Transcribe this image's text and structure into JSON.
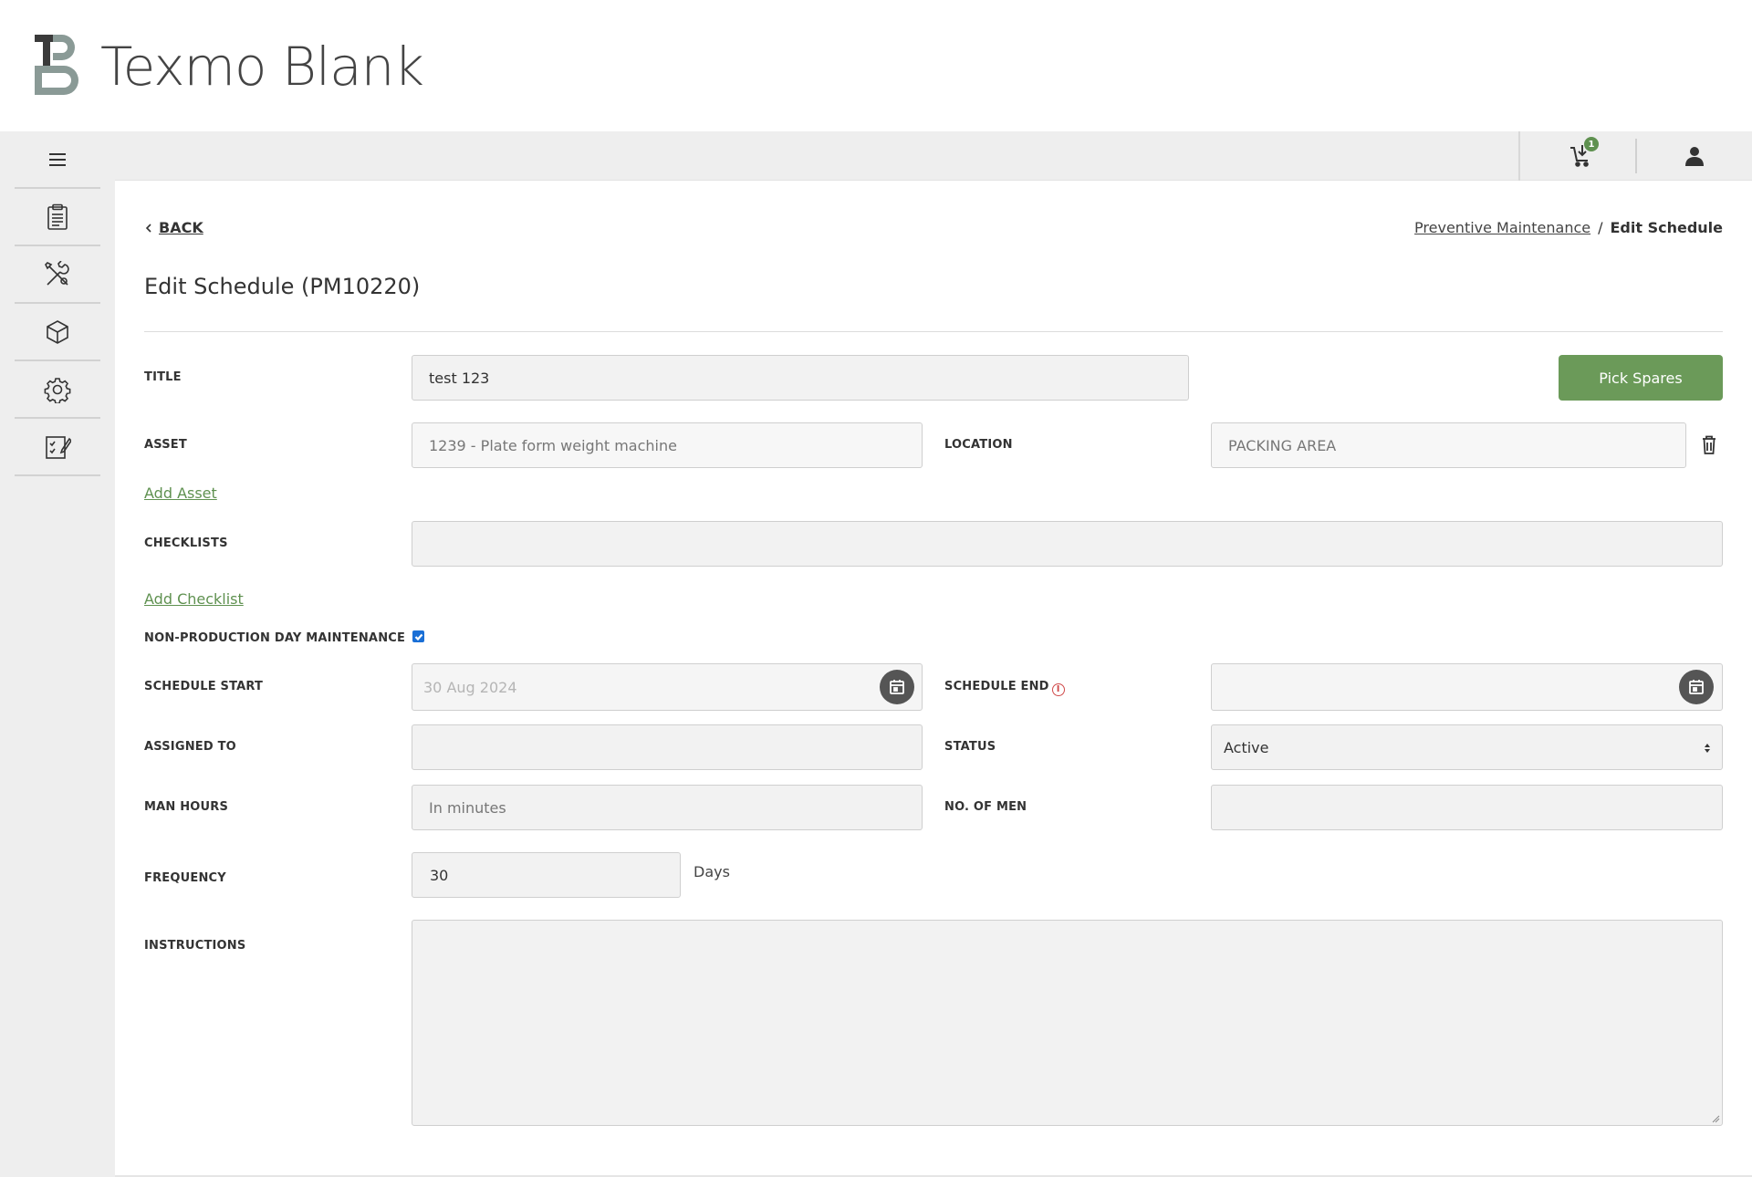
{
  "brand": {
    "name": "Texmo Blank"
  },
  "topbar": {
    "cart_badge": "1"
  },
  "sidebar": {
    "items": [
      {
        "icon": "menu-icon"
      },
      {
        "icon": "clipboard-icon"
      },
      {
        "icon": "tools-icon"
      },
      {
        "icon": "box-icon"
      },
      {
        "icon": "gear-icon"
      },
      {
        "icon": "checklist-edit-icon"
      }
    ]
  },
  "nav": {
    "back_label": "BACK",
    "breadcrumb": {
      "parent": "Preventive Maintenance",
      "separator": "/",
      "current": "Edit Schedule"
    }
  },
  "page": {
    "title": "Edit Schedule (PM10220)"
  },
  "form": {
    "title_label": "TITLE",
    "title_value": "test 123",
    "pick_spares_label": "Pick Spares",
    "asset_label": "ASSET",
    "asset_value": "1239 - Plate form weight machine",
    "location_label": "LOCATION",
    "location_value": "PACKING AREA",
    "add_asset_label": "Add Asset",
    "checklists_label": "CHECKLISTS",
    "checklists_value": "",
    "add_checklist_label": "Add Checklist",
    "non_production_label": "NON-PRODUCTION DAY MAINTENANCE",
    "non_production_checked": true,
    "schedule_start_label": "SCHEDULE START",
    "schedule_start_value": "30 Aug 2024",
    "schedule_end_label": "SCHEDULE END",
    "schedule_end_value": "",
    "assigned_to_label": "ASSIGNED TO",
    "assigned_to_value": "",
    "status_label": "STATUS",
    "status_value": "Active",
    "man_hours_label": "MAN HOURS",
    "man_hours_placeholder": "In minutes",
    "no_of_men_label": "NO. OF MEN",
    "no_of_men_value": "",
    "frequency_label": "FREQUENCY",
    "frequency_value": "30",
    "frequency_unit": "Days",
    "instructions_label": "INSTRUCTIONS",
    "instructions_value": ""
  },
  "colors": {
    "accent_green": "#6b9a59",
    "link_green": "#5f9150",
    "info_red": "#d04a4a",
    "checkbox_blue": "#1a6fd6"
  }
}
